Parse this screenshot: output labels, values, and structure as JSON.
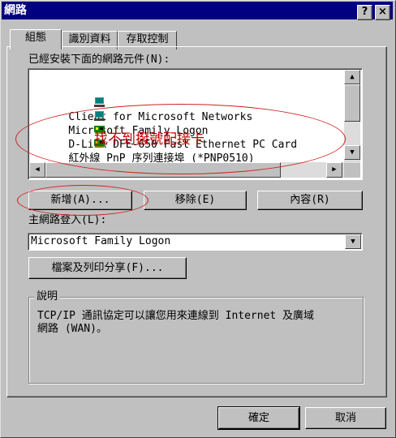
{
  "window": {
    "title": "網路"
  },
  "titlebar": {
    "help_label": "?",
    "close_label": "×"
  },
  "tabs": [
    {
      "label": "組態"
    },
    {
      "label": "識別資料"
    },
    {
      "label": "存取控制"
    }
  ],
  "components": {
    "label": "已經安裝下面的網路元件(N):",
    "items": [
      {
        "label": "Client for Microsoft Networks",
        "icon": "client-icon"
      },
      {
        "label": "Microsoft Family Logon",
        "icon": "client-icon"
      },
      {
        "label": "D-Link DFE-650 Fast Ethernet PC Card",
        "icon": "network-card-icon"
      },
      {
        "label": "紅外線 PnP 序列連接埠 (*PNP0510)",
        "icon": "network-card-icon"
      }
    ]
  },
  "annotation": {
    "text": "找不到撥號配接卡",
    "color": "#c00000"
  },
  "buttons": {
    "add": "新增(A)...",
    "remove": "移除(E)",
    "properties": "內容(R)"
  },
  "primary_logon": {
    "label": "主網路登入(L):",
    "value": "Microsoft Family Logon"
  },
  "file_print_sharing": {
    "label": "檔案及列印分享(F)..."
  },
  "description": {
    "label": "說明",
    "line1": "TCP/IP 通訊協定可以讓您用來連線到 Internet 及廣域",
    "line2": "網路 (WAN)。"
  },
  "footer": {
    "ok": "確定",
    "cancel": "取消"
  },
  "colors": {
    "titlebar": "#000080",
    "face": "#c0c0c0",
    "annotation": "#c00000"
  }
}
